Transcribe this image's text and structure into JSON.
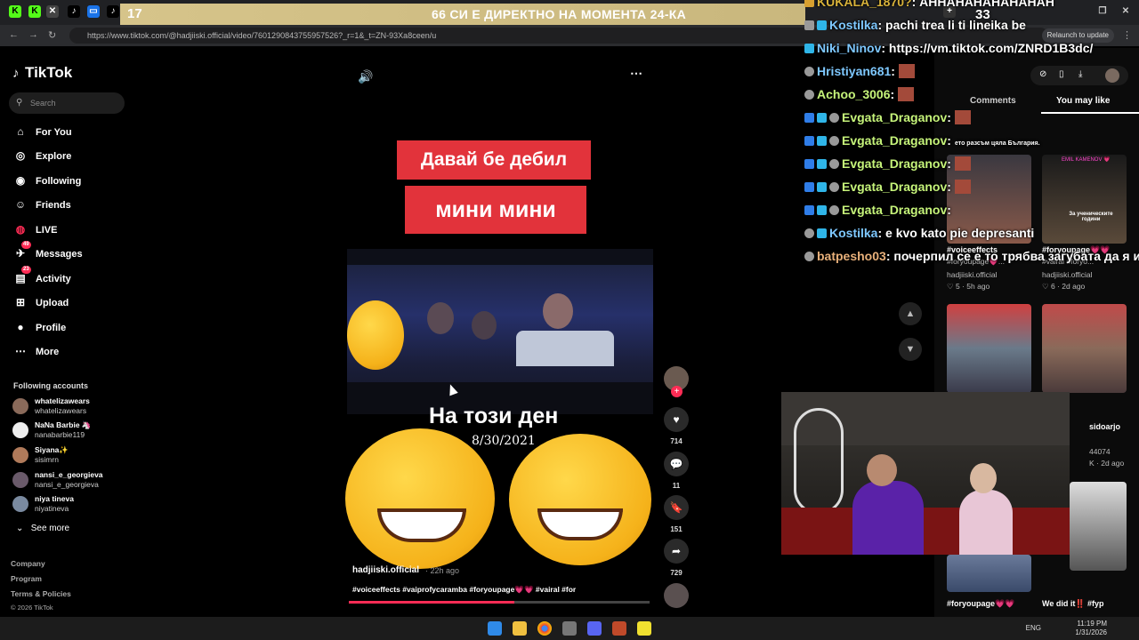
{
  "browser": {
    "url": "https://www.tiktok.com/@hadjiiski.official/video/7601290843755957526?_r=1&_t=ZN-93Xa8ceen/u",
    "relaunch_label": "Relaunch to update"
  },
  "banner": {
    "count": "17",
    "text": "66 СИ Е ДИРЕКТНО НА МОМЕНТА 24-КА"
  },
  "sidebar": {
    "logo": "TikTok",
    "search_placeholder": "Search",
    "nav": [
      {
        "label": "For You",
        "icon": "home-icon"
      },
      {
        "label": "Explore",
        "icon": "compass-icon"
      },
      {
        "label": "Following",
        "icon": "following-icon"
      },
      {
        "label": "Friends",
        "icon": "friends-icon"
      },
      {
        "label": "LIVE",
        "icon": "live-icon"
      },
      {
        "label": "Messages",
        "icon": "messages-icon",
        "badge": "49"
      },
      {
        "label": "Activity",
        "icon": "activity-icon",
        "badge": "23"
      },
      {
        "label": "Upload",
        "icon": "upload-icon"
      },
      {
        "label": "Profile",
        "icon": "profile-icon"
      },
      {
        "label": "More",
        "icon": "more-icon"
      }
    ],
    "following_title": "Following accounts",
    "accounts": [
      {
        "name": "whatelizawears",
        "user": "whatelizawears"
      },
      {
        "name": "NaNa Barbie 🦄",
        "user": "nanabarbie119"
      },
      {
        "name": "Siyana✨",
        "user": "sisimrn"
      },
      {
        "name": "nansi_e_georgieva",
        "user": "nansi_e_georgieva"
      },
      {
        "name": "niya tineva",
        "user": "niyatineva"
      }
    ],
    "see_more": "See more",
    "footer": [
      "Company",
      "Program",
      "Terms & Policies",
      "© 2026 TikTok"
    ]
  },
  "video": {
    "caption1": "Давай бе дебил",
    "caption2": "мини мини",
    "day_text": "На този ден",
    "date_text": "8/30/2021",
    "author": "hadjiiski.official",
    "time": "· 22h ago",
    "tags": "#voiceeffects #vaiprofycaramba #foryoupage💗💗 #vairal #for",
    "progress": 0.55
  },
  "actions": {
    "likes": "714",
    "comments": "11",
    "saves": "151",
    "shares": "729"
  },
  "right_panel": {
    "tab_comments": "Comments",
    "tab_you_may_like": "You may like",
    "items": [
      {
        "label": "#voiceeffects",
        "sub": "#foryoupage💗...",
        "author": "hadjiiski.official",
        "likes": "♡ 5",
        "time": "· 5h ago"
      },
      {
        "label": "#foryoupage💗💗",
        "sub": "#vairal #foryo...",
        "author": "hadjiiski.official",
        "likes": "♡ 6",
        "time": "· 2d ago"
      },
      {
        "label": "sidoarjo",
        "sub": "44074",
        "author": "",
        "likes": "K",
        "time": "· 2d ago"
      },
      {
        "label": "#foryoupage💗💗",
        "sub": "",
        "author": "",
        "likes": "",
        "time": ""
      },
      {
        "label": "We did it‼️ #fyp",
        "sub": "",
        "author": "",
        "likes": "",
        "time": ""
      }
    ],
    "thumb_texts": [
      "EMIL KAMENOV 💗",
      "За ученическите години"
    ]
  },
  "chat": [
    {
      "user": "KUKALA_1870?",
      "msg": ": АННАНАНАНАНАНАН",
      "color": "#d8b23a"
    },
    {
      "user": "Kostilka",
      "msg": ": pachi trea li ti lineika be",
      "color": "#7ec8ff"
    },
    {
      "user": "Niki_Ninov",
      "msg": ": https://vm.tiktok.com/ZNRD1B3dc/",
      "color": "#7ec8ff"
    },
    {
      "user": "Hristiyan681",
      "msg": ":",
      "color": "#7ec8ff"
    },
    {
      "user": "Achoo_3006",
      "msg": ":",
      "color": "#c6f47a"
    },
    {
      "user": "Evgata_Draganov",
      "msg": ":",
      "color": "#c6f47a"
    },
    {
      "user": "Evgata_Draganov",
      "msg": ":",
      "color": "#c6f47a"
    },
    {
      "user": "Evgata_Draganov",
      "msg": ":",
      "color": "#c6f47a"
    },
    {
      "user": "Evgata_Draganov",
      "msg": ":",
      "color": "#c6f47a"
    },
    {
      "user": "Evgata_Draganov",
      "msg": ":",
      "color": "#c6f47a"
    },
    {
      "user": "Kostilka",
      "msg": ": e kvo kato pie depresanti",
      "color": "#7ec8ff"
    },
    {
      "user": "batpesho03",
      "msg": ": почерпил се е то трябва загубата да я из",
      "color": "#e8b07a"
    }
  ],
  "chat_count": "33",
  "chat_overlay_note": "ето разсъм цяла България.",
  "taskbar": {
    "lang": "ENG",
    "time": "11:19 PM",
    "date": "1/31/2026"
  }
}
